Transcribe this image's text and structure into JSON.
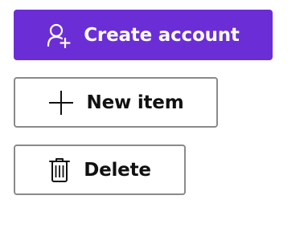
{
  "buttons": {
    "create_account": {
      "label": "Create account",
      "icon": "person-add-icon",
      "color": "#6b2ed6"
    },
    "new_item": {
      "label": "New item",
      "icon": "plus-icon"
    },
    "delete": {
      "label": "Delete",
      "icon": "trash-icon"
    }
  }
}
